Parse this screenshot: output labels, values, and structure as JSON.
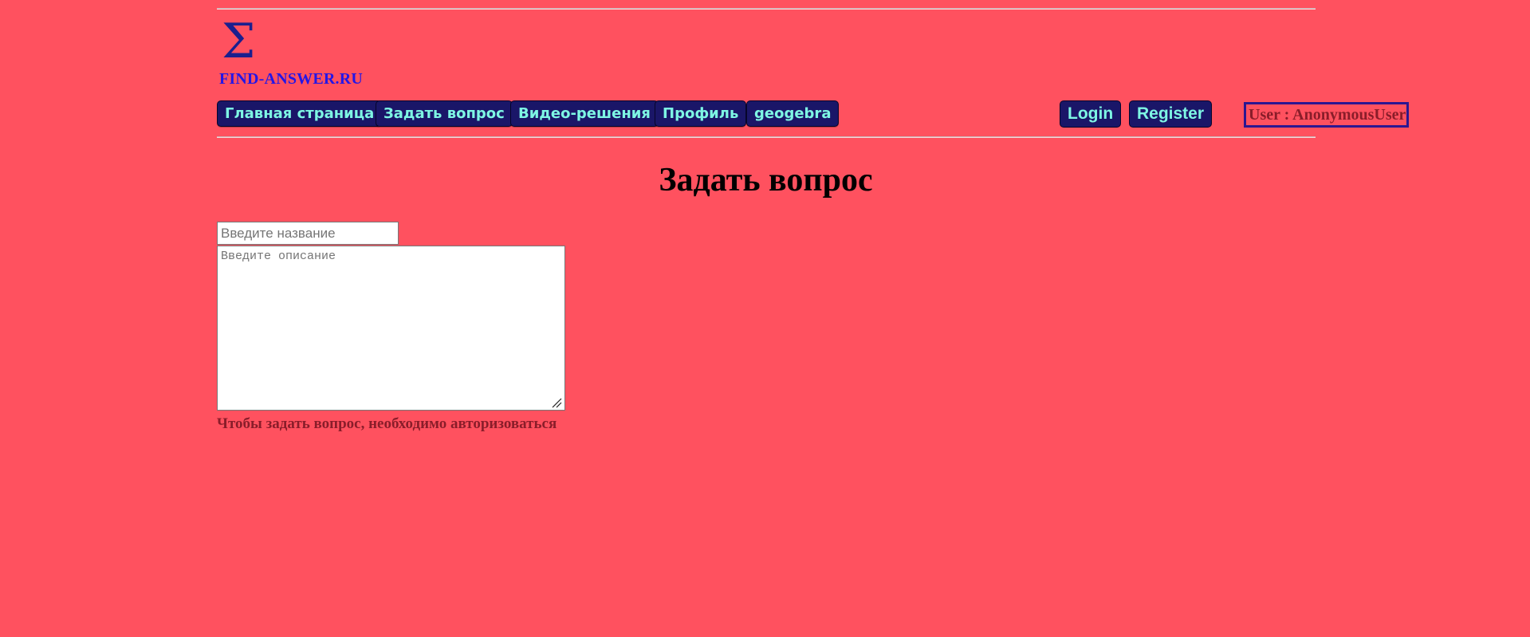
{
  "header": {
    "logo_symbol": "Σ",
    "site_name": "FIND-ANSWER.RU"
  },
  "nav": {
    "items": [
      {
        "label": "Главная страница"
      },
      {
        "label": "Задать вопрос"
      },
      {
        "label": "Видео-решения"
      },
      {
        "label": "Профиль"
      },
      {
        "label": "geogebra"
      }
    ]
  },
  "auth": {
    "login_label": "Login",
    "register_label": "Register",
    "user_status": "User : AnonymousUser"
  },
  "main": {
    "title": "Задать вопрос",
    "title_input_placeholder": "Введите название",
    "title_input_value": "",
    "description_placeholder": "Введите описание",
    "description_value": "",
    "auth_required_message": "Чтобы задать вопрос, необходимо авторизоваться"
  },
  "colors": {
    "background": "#ff515f",
    "button_bg": "#1a1668",
    "button_text": "#7ef7e4",
    "logo_text": "#2416e6",
    "warning_text": "#8a1d2a"
  }
}
